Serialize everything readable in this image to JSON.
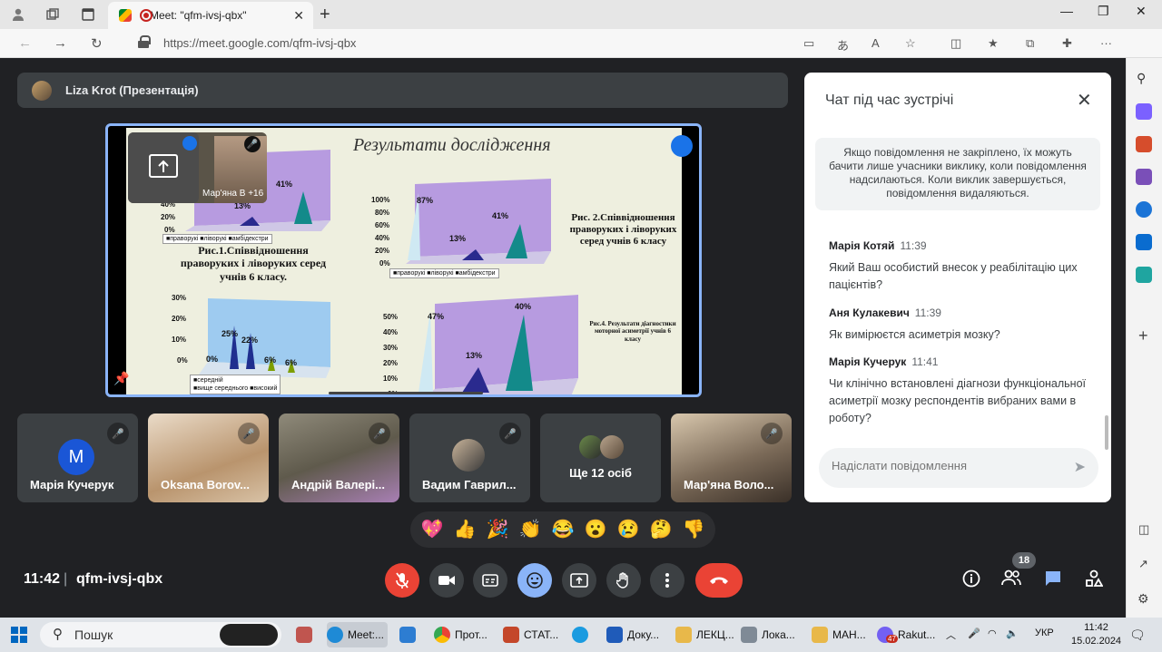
{
  "browser": {
    "tab_title": "Meet: \"qfm-ivsj-qbx\"",
    "url": "https://meet.google.com/qfm-ivsj-qbx"
  },
  "presentation": {
    "presenter": "Liza Krot (Презентація)",
    "slide_title": "Результати дослідження",
    "self_view_name": "Мар'яна В +16",
    "charts": [
      {
        "type": "bar",
        "caption": "Рис.1.Співвідношення праворуких і ліворуких серед учнів 6 класу.",
        "y_ticks": [
          "40%",
          "20%",
          "0%"
        ],
        "values": [
          "41%",
          "13%"
        ],
        "legend": [
          "праворукі",
          "ліворукі",
          "амбідекстри"
        ]
      },
      {
        "type": "bar",
        "caption": "Рис. 2.Співвідношення праворуких і ліворуких серед учнів 6 класу",
        "y_ticks": [
          "100%",
          "80%",
          "60%",
          "40%",
          "20%",
          "0%"
        ],
        "values": [
          "87%",
          "13%",
          "41%"
        ],
        "legend": [
          "праворукі",
          "ліворукі",
          "амбідекстри"
        ]
      },
      {
        "type": "bar",
        "y_ticks": [
          "30%",
          "20%",
          "10%",
          "0%"
        ],
        "values": [
          "0%",
          "25%",
          "22%",
          "6%",
          "6%"
        ],
        "legend": [
          "середній",
          "вище середнього",
          "високий"
        ]
      },
      {
        "type": "bar",
        "caption": "Рис.4. Результати діагностики моторної асиметрії учнів 6 класу",
        "y_ticks": [
          "50%",
          "40%",
          "30%",
          "20%",
          "10%",
          "0%"
        ],
        "values": [
          "47%",
          "13%",
          "40%"
        ]
      }
    ]
  },
  "participants": [
    {
      "name": "Марія Кучерук",
      "initial": "M"
    },
    {
      "name": "Oksana Borov..."
    },
    {
      "name": "Андрій Валері..."
    },
    {
      "name": "Вадим Гаврил..."
    },
    {
      "name": "Ще 12 осіб"
    },
    {
      "name": "Мар'яна Воло..."
    }
  ],
  "chat": {
    "title": "Чат під час зустрічі",
    "notice": "Якщо повідомлення не закріплено, їх можуть бачити лише учасники виклику, коли повідомлення надсилаються. Коли виклик завершується, повідомлення видаляються.",
    "messages": [
      {
        "author": "Марія Котяй",
        "time": "11:39",
        "text": "Який Ваш особистий внесок у реабілітацію цих пацієнтів?"
      },
      {
        "author": "Аня Кулакевич",
        "time": "11:39",
        "text": "Як вимірюєтся асиметрія мозку?"
      },
      {
        "author": "Марія Кучерук",
        "time": "11:41",
        "text": "Чи клінічно встановлені діагнози функціональної асиметрії мозку респондентів вибраних вами в роботу?"
      }
    ],
    "input_placeholder": "Надіслати повідомлення"
  },
  "reactions": [
    "💖",
    "👍",
    "🎉",
    "👏",
    "😂",
    "😮",
    "😢",
    "🤔",
    "👎"
  ],
  "bottom_bar": {
    "time": "11:42",
    "separator": "|",
    "meeting_code": "qfm-ivsj-qbx",
    "participant_count": "18"
  },
  "taskbar": {
    "search_label": "Пошук",
    "apps": [
      "Meet:...",
      "Прот...",
      "СТАТ...",
      "Доку...",
      "ЛЕКЦ...",
      "Лока...",
      "MAH...",
      "Rakut..."
    ],
    "notification_count": "47",
    "lang": "УКР",
    "time": "11:42",
    "date": "15.02.2024"
  },
  "colors": {
    "accent": "#8ab4f8",
    "end_call": "#ea4335",
    "mic_off": "#ea4335"
  }
}
